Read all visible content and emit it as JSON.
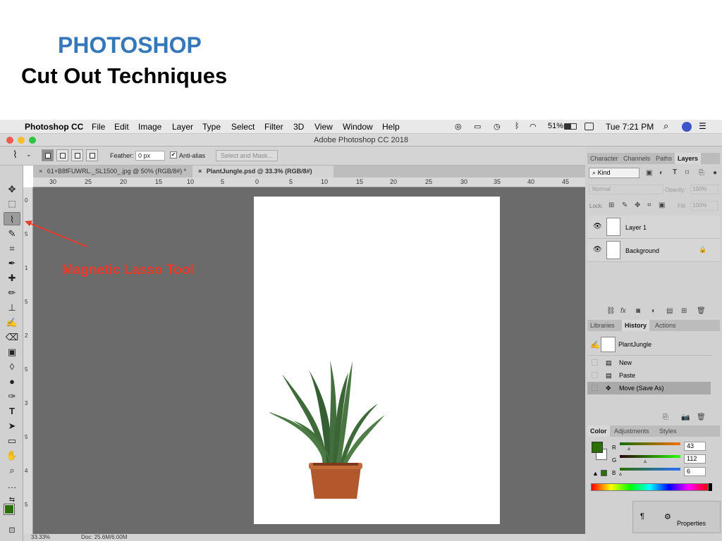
{
  "slide": {
    "title": "PHOTOSHOP",
    "subtitle": "Cut Out Techniques"
  },
  "menubar": {
    "app_name": "Photoshop CC",
    "items": [
      "File",
      "Edit",
      "Image",
      "Layer",
      "Type",
      "Select",
      "Filter",
      "3D",
      "View",
      "Window",
      "Help"
    ],
    "battery": "51%",
    "clock": "Tue 7:21 PM"
  },
  "window": {
    "title": "Adobe Photoshop CC 2018"
  },
  "options_bar": {
    "feather_label": "Feather:",
    "feather_value": "0 px",
    "antialias_label": "Anti-alias",
    "antialias_checked": "✔",
    "select_mask_label": "Select and Mask..."
  },
  "documents": {
    "tabs": [
      {
        "label": "61+B8fFUWRL._SL1500_.jpg @ 50% (RGB/8#) *",
        "close": "×"
      },
      {
        "label": "PlantJungle.psd @ 33.3% (RGB/8#)",
        "close": "×"
      }
    ]
  },
  "rulers": {
    "top": [
      "30",
      "25",
      "20",
      "15",
      "10",
      "5",
      "0",
      "5",
      "10",
      "15",
      "20",
      "25",
      "30",
      "35",
      "40",
      "45"
    ],
    "left": [
      "0",
      "5",
      "1",
      "5",
      "2",
      "5",
      "3",
      "5",
      "4",
      "5"
    ]
  },
  "status": {
    "zoom": "33.33%",
    "doc": "Doc: 25.6M/6.00M"
  },
  "annotation": {
    "label": "Magnetic Lasso Tool"
  },
  "layers_panel": {
    "tabs": [
      "Character",
      "Channels",
      "Paths",
      "Layers"
    ],
    "active_tab": "Layers",
    "kind_filter": "Kind",
    "blend_mode": "Normal",
    "opacity_label": "Opacity:",
    "opacity_value": "100%",
    "lock_label": "Lock:",
    "fill_label": "Fill:",
    "fill_value": "100%",
    "layers": [
      {
        "name": "Layer 1"
      },
      {
        "name": "Background"
      }
    ]
  },
  "history_panel": {
    "tabs": [
      "Libraries",
      "History",
      "Actions"
    ],
    "active_tab": "History",
    "snapshot": "PlantJungle",
    "states": [
      "New",
      "Paste",
      "Move (Save As)"
    ],
    "selected_state": "Move (Save As)"
  },
  "color_panel": {
    "tabs": [
      "Color",
      "Adjustments",
      "Styles"
    ],
    "active_tab": "Color",
    "channels": [
      {
        "label": "R",
        "value": "43"
      },
      {
        "label": "G",
        "value": "112"
      },
      {
        "label": "B",
        "value": "6"
      }
    ],
    "foreground_color": "#2b7006"
  },
  "properties_panel": {
    "label": "Properties"
  },
  "colors": {
    "accent_title": "#3577b9",
    "annotation_red": "#e73c2b"
  }
}
